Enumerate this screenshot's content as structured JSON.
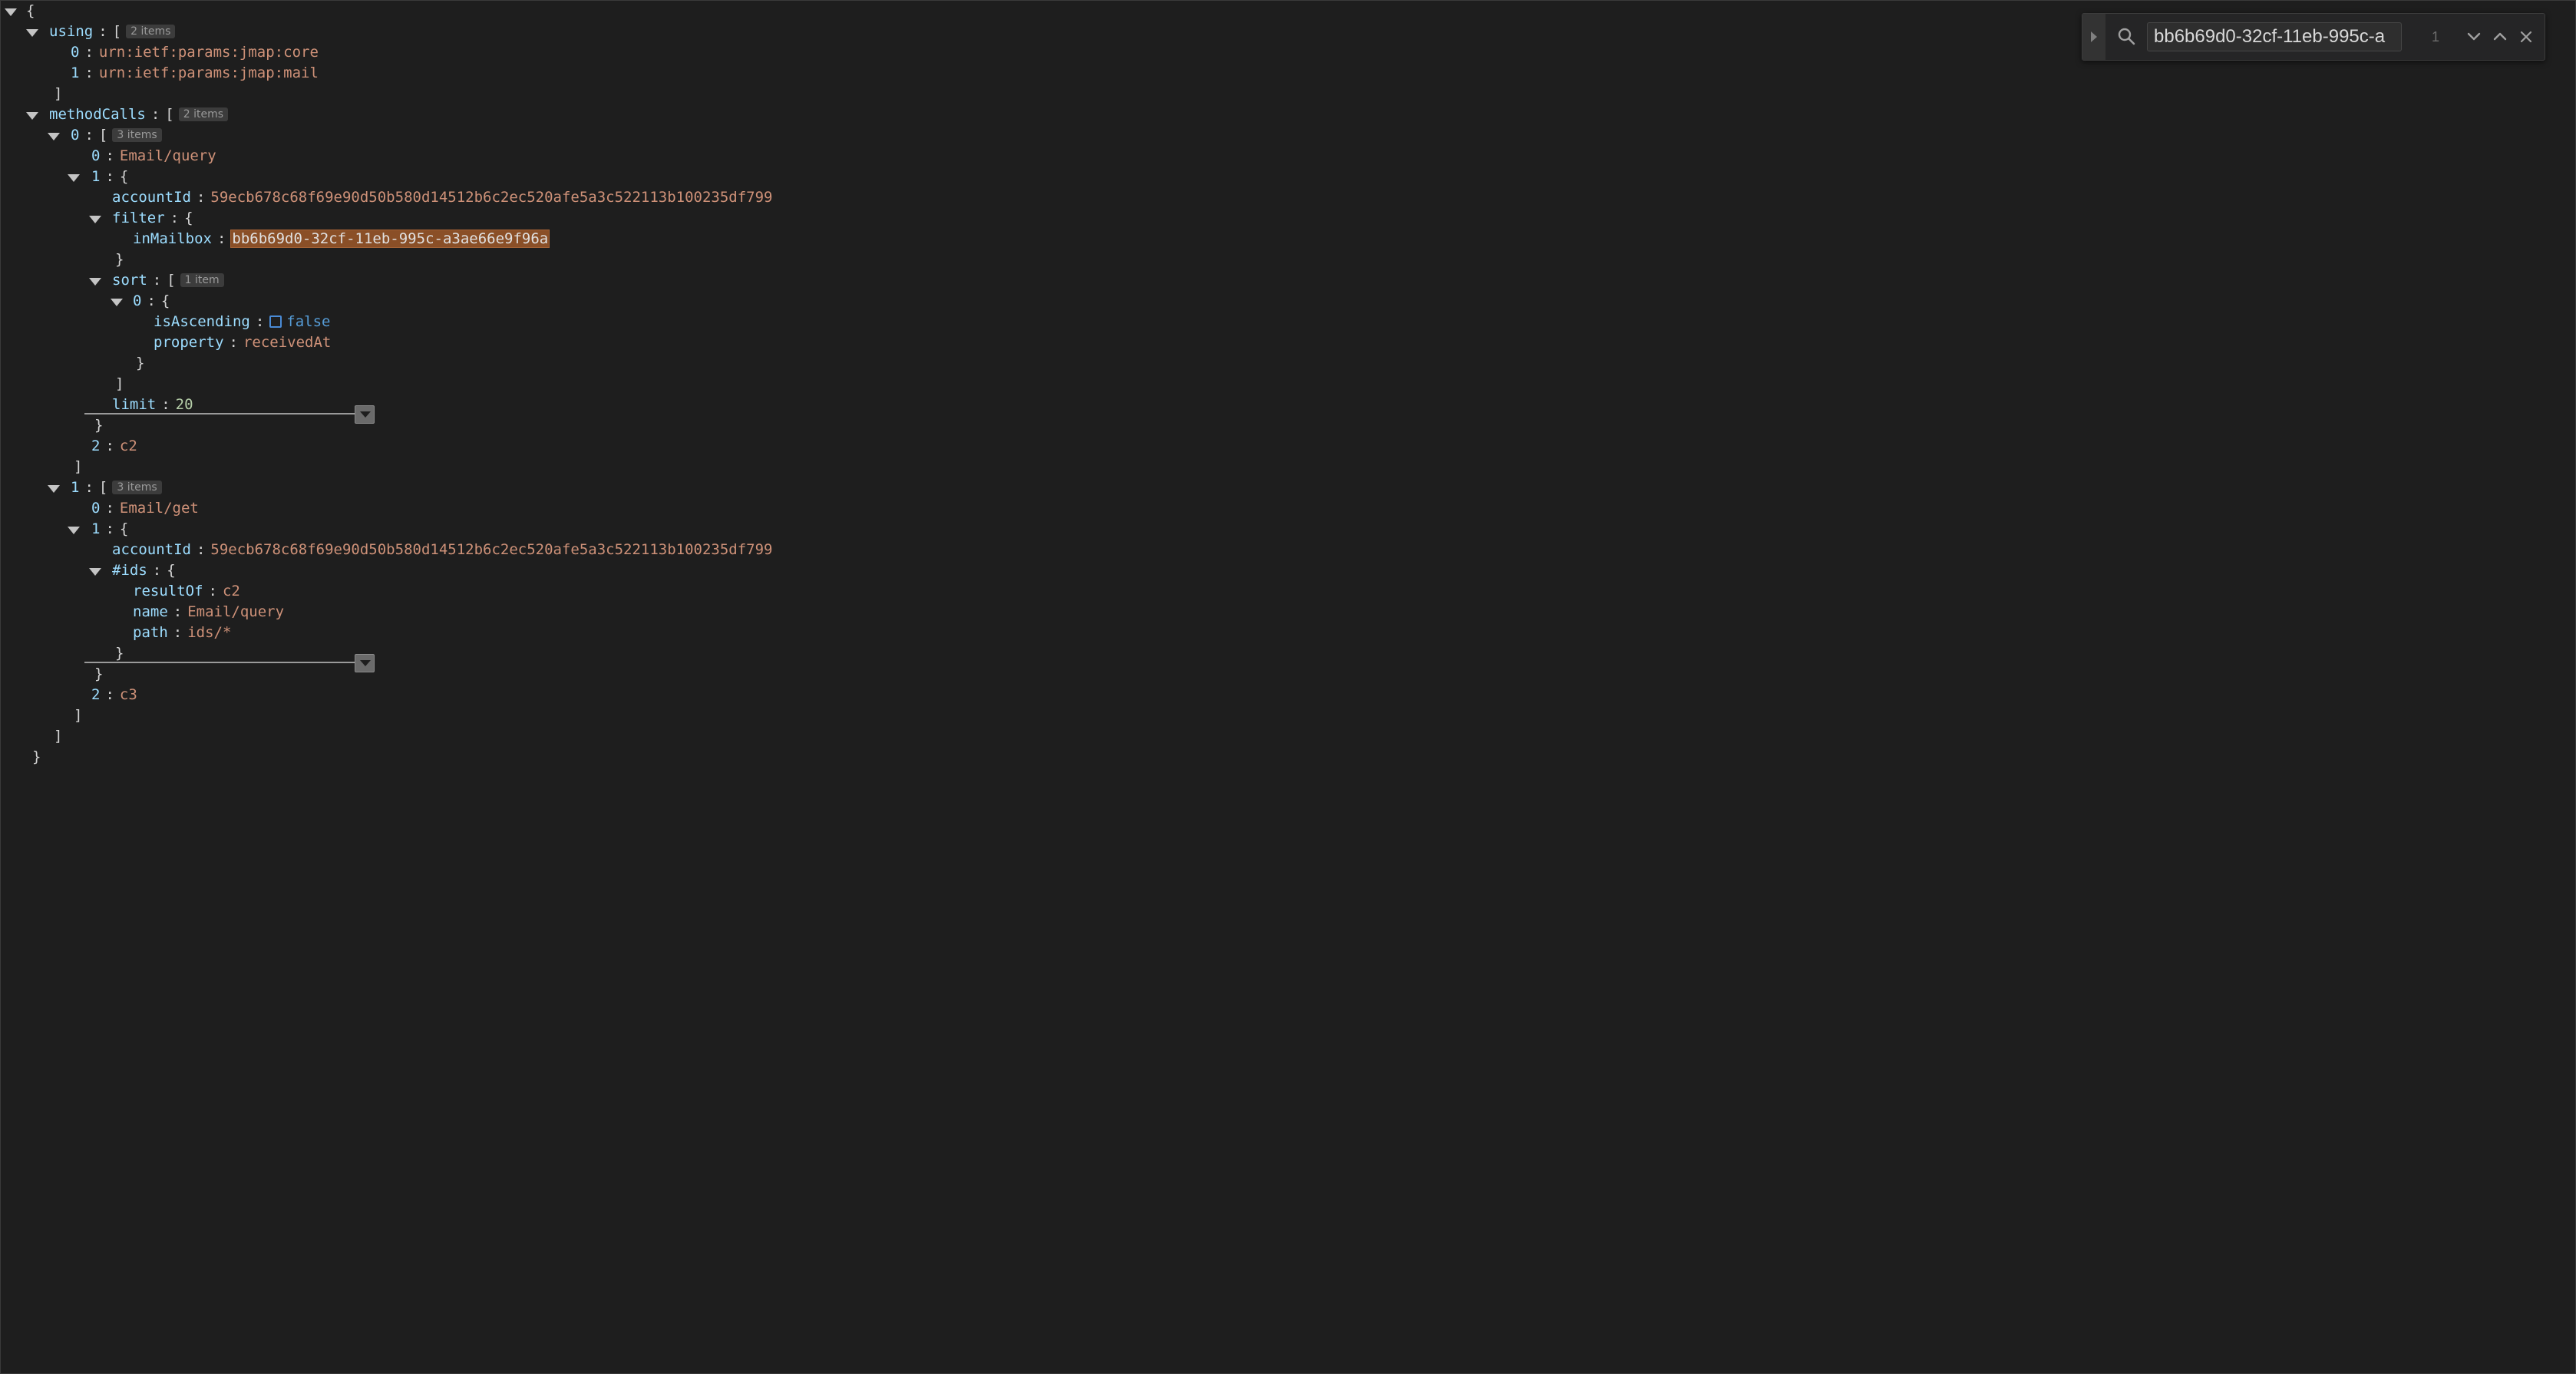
{
  "tree": {
    "root_open": "{",
    "root_close": "}",
    "using": {
      "key": "using",
      "open": "[",
      "badge": "2 items",
      "items": [
        {
          "index": "0",
          "value": "urn:ietf:params:jmap:core"
        },
        {
          "index": "1",
          "value": "urn:ietf:params:jmap:mail"
        }
      ],
      "close": "]"
    },
    "methodCalls": {
      "key": "methodCalls",
      "open": "[",
      "badge": "2 items",
      "close": "]",
      "call0": {
        "index": "0",
        "open": "[",
        "badge": "3 items",
        "close": "]",
        "name_index": "0",
        "name": "Email/query",
        "args_index": "1",
        "args_open": "{",
        "args_close": "}",
        "accountId_key": "accountId",
        "accountId": "59ecb678c68f69e90d50b580d14512b6c2ec520afe5a3c522113b100235df799",
        "filter_key": "filter",
        "filter_open": "{",
        "filter_close": "}",
        "inMailbox_key": "inMailbox",
        "inMailbox": "bb6b69d0-32cf-11eb-995c-a3ae66e9f96a",
        "sort_key": "sort",
        "sort_open": "[",
        "sort_badge": "1 item",
        "sort_close": "]",
        "sort0_index": "0",
        "sort0_open": "{",
        "sort0_close": "}",
        "isAscending_key": "isAscending",
        "isAscending": "false",
        "property_key": "property",
        "property": "receivedAt",
        "limit_key": "limit",
        "limit": "20",
        "tag_index": "2",
        "tag": "c2"
      },
      "call1": {
        "index": "1",
        "open": "[",
        "badge": "3 items",
        "close": "]",
        "name_index": "0",
        "name": "Email/get",
        "args_index": "1",
        "args_open": "{",
        "args_close": "}",
        "accountId_key": "accountId",
        "accountId": "59ecb678c68f69e90d50b580d14512b6c2ec520afe5a3c522113b100235df799",
        "ids_key": "#ids",
        "ids_open": "{",
        "ids_close": "}",
        "resultOf_key": "resultOf",
        "resultOf": "c2",
        "name_key": "name",
        "name_value": "Email/query",
        "path_key": "path",
        "path": "ids/*",
        "tag_index": "2",
        "tag": "c3"
      }
    },
    "colon": ":"
  },
  "find": {
    "query": "bb6b69d0-32cf-11eb-995c-a",
    "count": "1",
    "icons": {
      "toggle": "chevron-right-icon",
      "search": "search-icon",
      "next": "chevron-down-icon",
      "prev": "chevron-up-icon",
      "close": "close-icon"
    }
  },
  "colors": {
    "background": "#1e1e1e",
    "key": "#9cdcfe",
    "string": "#ce9178",
    "number": "#b5cea8",
    "boolean": "#569cd6",
    "highlight": "#8a4f27"
  }
}
